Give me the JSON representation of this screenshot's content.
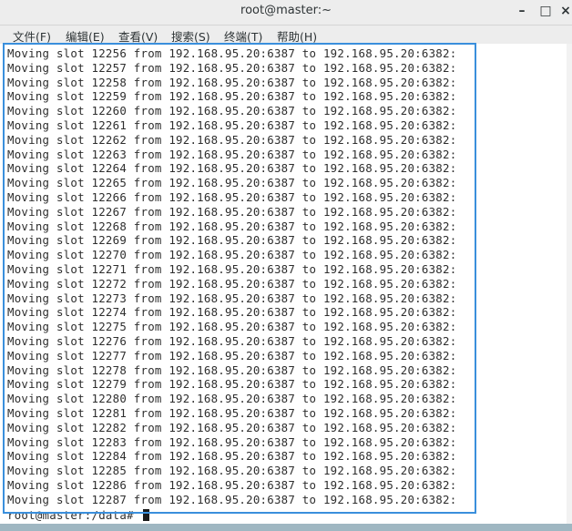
{
  "window": {
    "title": "root@master:~",
    "minimize_label": "–",
    "maximize_label": "□",
    "close_label": "×"
  },
  "menu": {
    "items": [
      {
        "label": "文件(F)"
      },
      {
        "label": "编辑(E)"
      },
      {
        "label": "查看(V)"
      },
      {
        "label": "搜索(S)"
      },
      {
        "label": "终端(T)"
      },
      {
        "label": "帮助(H)"
      }
    ]
  },
  "terminal": {
    "lines": [
      "Moving slot 12256 from 192.168.95.20:6387 to 192.168.95.20:6382:",
      "Moving slot 12257 from 192.168.95.20:6387 to 192.168.95.20:6382:",
      "Moving slot 12258 from 192.168.95.20:6387 to 192.168.95.20:6382:",
      "Moving slot 12259 from 192.168.95.20:6387 to 192.168.95.20:6382:",
      "Moving slot 12260 from 192.168.95.20:6387 to 192.168.95.20:6382:",
      "Moving slot 12261 from 192.168.95.20:6387 to 192.168.95.20:6382:",
      "Moving slot 12262 from 192.168.95.20:6387 to 192.168.95.20:6382:",
      "Moving slot 12263 from 192.168.95.20:6387 to 192.168.95.20:6382:",
      "Moving slot 12264 from 192.168.95.20:6387 to 192.168.95.20:6382:",
      "Moving slot 12265 from 192.168.95.20:6387 to 192.168.95.20:6382:",
      "Moving slot 12266 from 192.168.95.20:6387 to 192.168.95.20:6382:",
      "Moving slot 12267 from 192.168.95.20:6387 to 192.168.95.20:6382:",
      "Moving slot 12268 from 192.168.95.20:6387 to 192.168.95.20:6382:",
      "Moving slot 12269 from 192.168.95.20:6387 to 192.168.95.20:6382:",
      "Moving slot 12270 from 192.168.95.20:6387 to 192.168.95.20:6382:",
      "Moving slot 12271 from 192.168.95.20:6387 to 192.168.95.20:6382:",
      "Moving slot 12272 from 192.168.95.20:6387 to 192.168.95.20:6382:",
      "Moving slot 12273 from 192.168.95.20:6387 to 192.168.95.20:6382:",
      "Moving slot 12274 from 192.168.95.20:6387 to 192.168.95.20:6382:",
      "Moving slot 12275 from 192.168.95.20:6387 to 192.168.95.20:6382:",
      "Moving slot 12276 from 192.168.95.20:6387 to 192.168.95.20:6382:",
      "Moving slot 12277 from 192.168.95.20:6387 to 192.168.95.20:6382:",
      "Moving slot 12278 from 192.168.95.20:6387 to 192.168.95.20:6382:",
      "Moving slot 12279 from 192.168.95.20:6387 to 192.168.95.20:6382:",
      "Moving slot 12280 from 192.168.95.20:6387 to 192.168.95.20:6382:",
      "Moving slot 12281 from 192.168.95.20:6387 to 192.168.95.20:6382:",
      "Moving slot 12282 from 192.168.95.20:6387 to 192.168.95.20:6382:",
      "Moving slot 12283 from 192.168.95.20:6387 to 192.168.95.20:6382:",
      "Moving slot 12284 from 192.168.95.20:6387 to 192.168.95.20:6382:",
      "Moving slot 12285 from 192.168.95.20:6387 to 192.168.95.20:6382:",
      "Moving slot 12286 from 192.168.95.20:6387 to 192.168.95.20:6382:",
      "Moving slot 12287 from 192.168.95.20:6387 to 192.168.95.20:6382:"
    ],
    "prompt": "root@master:/data# "
  },
  "colors": {
    "highlight_border": "#3a8fdc",
    "text": "#2e2e2e",
    "chrome": "#ededed"
  }
}
